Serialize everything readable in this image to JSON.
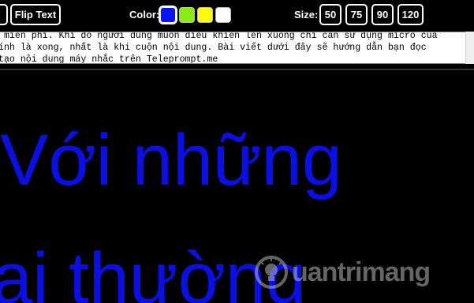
{
  "toolbar": {
    "prev_button_label": "t",
    "flip_button_label": "Flip Text",
    "color_label": "Color:",
    "size_label": "Size:",
    "colors": [
      {
        "name": "blue",
        "hex": "#0a14f0",
        "selected": true
      },
      {
        "name": "green",
        "hex": "#88ee11",
        "selected": false
      },
      {
        "name": "yellow",
        "hex": "#ffff00",
        "selected": false
      },
      {
        "name": "white",
        "hex": "#ffffff",
        "selected": false
      }
    ],
    "sizes": [
      "50",
      "75",
      "90",
      "120"
    ]
  },
  "script": {
    "lines": [
      " miễn phí. Khi đó người dùng muốn điều khiển lên xuống chỉ cần sử dụng micro của",
      "ính là xong, nhất là khi cuộn nội dung. Bài viết dưới đây sẽ hướng dẫn bạn đọc",
      "tạo nội dung máy nhắc trên Teleprompt.me"
    ]
  },
  "prompter": {
    "line1": "Với những",
    "line2": "ai thường",
    "text_color": "#0a0fe6"
  },
  "watermark": {
    "text": "uantrimang"
  }
}
